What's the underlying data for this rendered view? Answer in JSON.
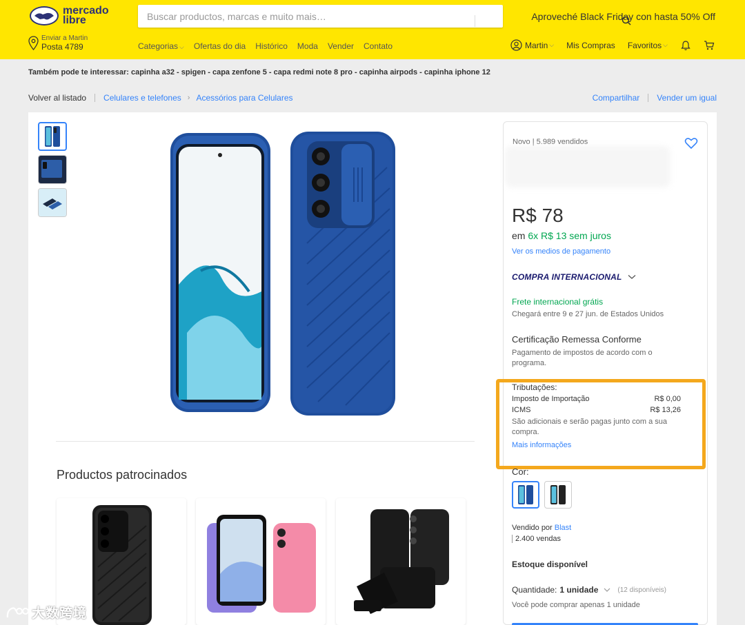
{
  "header": {
    "logo_line1": "mercado",
    "logo_line2": "libre",
    "search_placeholder": "Buscar productos, marcas e muito mais…",
    "promo": "Aproveché Black Friday con hasta 50% Off",
    "ship_to_label": "Enviar a Martin",
    "ship_to_code": "Posta 4789",
    "nav": [
      "Categorias",
      "Ofertas do dia",
      "Histórico",
      "Moda",
      "Vender",
      "Contato"
    ],
    "user": "Martin",
    "my_purchases": "Mis Compras",
    "favorites": "Favoritos"
  },
  "suggestions": {
    "label": "Também pode te interessar:",
    "items": [
      "capinha a32",
      "spigen",
      "capa zenfone 5",
      "capa redmi note 8 pro",
      "capinha airpods",
      "capinha iphone 12"
    ],
    "separator": " - "
  },
  "breadcrumb": {
    "back": "Volver al listado",
    "items": [
      "Celulares e telefones",
      "Acessórios para Celulares"
    ],
    "share": "Compartilhar",
    "sell": "Vender um igual"
  },
  "colors": {
    "brand_yellow": "#ffe600",
    "link_blue": "#3483fa",
    "green": "#00a650",
    "highlight_orange": "#f4a81d"
  },
  "sponsored": {
    "title": "Productos patrocinados"
  },
  "buybox": {
    "condition": "Novo | 5.989 vendidos",
    "price": "R$ 78",
    "installments_prefix": "em",
    "installments": "6x R$ 13 sem juros",
    "payment_link": "Ver os medios de pagamento",
    "international": "COMPRA INTERNACIONAL",
    "shipping_free": "Frete internacional grátis",
    "arrival": "Chegará entre 9 e 27 jun. de Estados Unidos",
    "cert_title": "Certificação Remessa Conforme",
    "cert_text": "Pagamento de impostos de acordo com o programa.",
    "tax_title": "Tributações:",
    "taxes": [
      {
        "label": "Imposto de Importação",
        "value": "R$ 0,00"
      },
      {
        "label": "ICMS",
        "value": "R$ 13,26"
      }
    ],
    "tax_note": "São adicionais e serão pagas junto com a sua compra.",
    "tax_link": "Mais informações",
    "color_label": "Cor:",
    "seller_prefix": "Vendido por",
    "seller_name": "Blast",
    "seller_sales": "2.400 vendas",
    "stock": "Estoque disponível",
    "qty_label": "Quantidade:",
    "qty_value": "1 unidade",
    "qty_available": "(12 disponíveis)",
    "qty_note": "Você pode comprar apenas 1 unidade"
  },
  "watermark": "大数跨境"
}
